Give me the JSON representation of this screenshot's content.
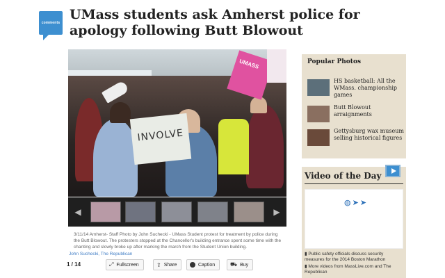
{
  "header": {
    "comments_label": "comments",
    "headline": "UMass students ask Amherst police for apology following Butt Blowout"
  },
  "photo": {
    "sign_text": "INVOLVE",
    "pink_sign_text": "UMASS",
    "caption": "3/11/14 Amherst- Staff Photo by John Suchecki - UMass Student protest for treatment by police during the Butt Blowout. The protesters stopped at the Chancellor's building entrance spent some time with the chanting and slowly broke up after marking the march from the Student Union building.",
    "byline": "John Suchecki, The Republican"
  },
  "filmstrip": {
    "prev": "◀",
    "next": "▶",
    "thumbs": [
      "#b89aa6",
      "#6f7380",
      "#8d8f98",
      "#7f828a",
      "#9b8f8a"
    ]
  },
  "controls": {
    "count": "1 / 14",
    "fullscreen": "Fullscreen",
    "share": "Share",
    "caption": "Caption",
    "buy": "Buy"
  },
  "popular": {
    "title": "Popular Photos",
    "items": [
      {
        "text": "HS basketball: All the WMass. championship games",
        "color": "#5c6f7a"
      },
      {
        "text": "Butt Blowout arraignments",
        "color": "#8a6f60"
      },
      {
        "text": "Gettysburg wax museum selling historical figures",
        "color": "#6a4a3a"
      }
    ]
  },
  "video": {
    "title": "Video of the Day",
    "links": [
      "Public safety officials discuss security measures for the 2014 Boston Marathon",
      "More videos from MassLive.com and The Republican"
    ]
  },
  "colors": {
    "accent": "#3d8fd0",
    "sidebar_bg": "#e8e0cf"
  }
}
